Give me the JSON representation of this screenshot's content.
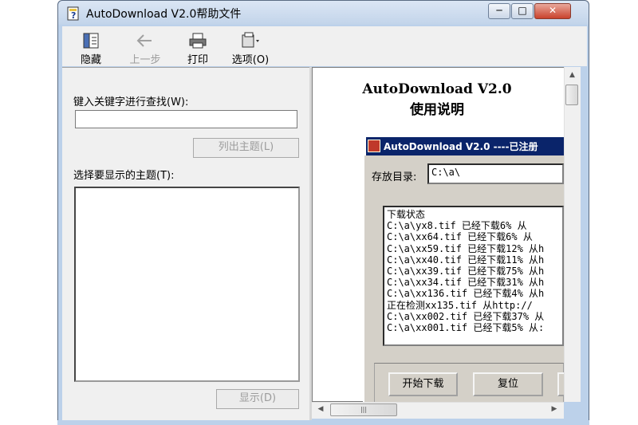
{
  "window": {
    "title": "AutoDownload V2.0帮助文件"
  },
  "caption": {
    "minimize": "─",
    "maximize": "□",
    "close": "✕"
  },
  "toolbar": {
    "hide": "隐藏",
    "back": "上一步",
    "print": "打印",
    "options": "选项(O)"
  },
  "left": {
    "keyword_label": "键入关键字进行查找(W):",
    "keyword_value": "",
    "list_topics": "列出主题(L)",
    "select_label": "选择要显示的主题(T):",
    "display": "显示(D)"
  },
  "doc": {
    "title_line1": "AutoDownload V2.0",
    "title_line2": "使用说明",
    "app": {
      "title": "AutoDownload V2.0 ----已注册",
      "dir_label": "存放目录:",
      "dir_value": "C:\\a\\",
      "log_lines": [
        "下载状态",
        "C:\\a\\yx8.tif 已经下载6% 从",
        "C:\\a\\xx64.tif 已经下载6% 从",
        "C:\\a\\xx59.tif 已经下载12% 从h",
        "C:\\a\\xx40.tif 已经下载11% 从h",
        "C:\\a\\xx39.tif 已经下载75% 从h",
        "C:\\a\\xx34.tif 已经下载31% 从h",
        "C:\\a\\xx136.tif 已经下载4% 从h",
        "正在检测xx135.tif 从http://",
        "C:\\a\\xx002.tif 已经下载37% 从",
        "C:\\a\\xx001.tif 已经下载5% 从:"
      ],
      "start_btn": "开始下载",
      "reset_btn": "复位"
    }
  },
  "scroll": {
    "up": "▲",
    "left": "◀",
    "right": "▶",
    "grip": "|||"
  }
}
